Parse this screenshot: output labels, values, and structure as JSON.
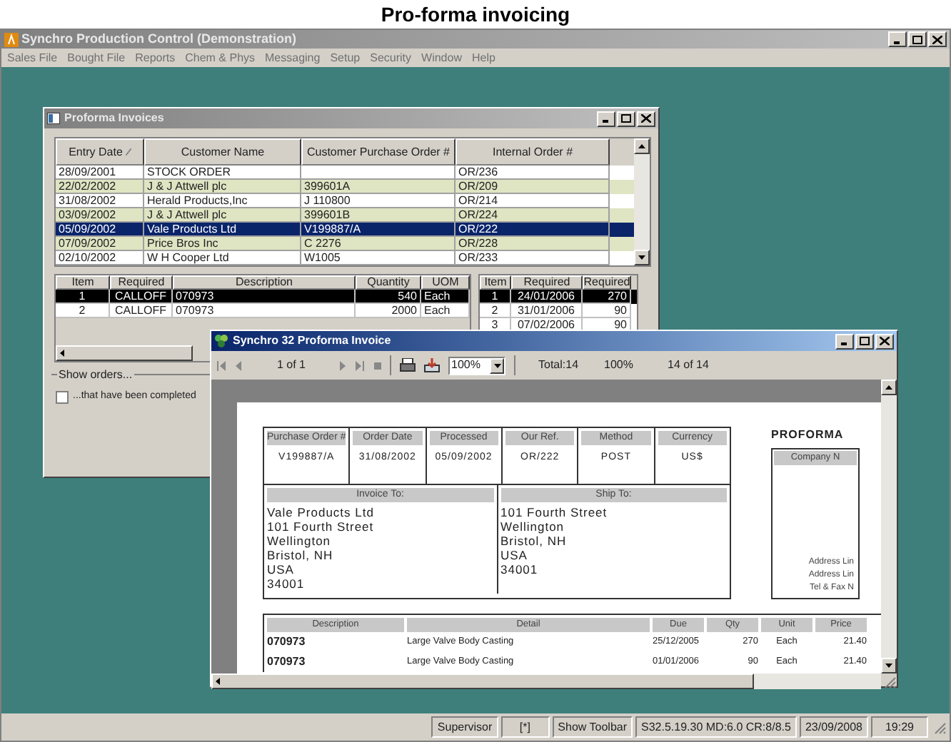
{
  "caption": "Pro-forma invoicing",
  "app": {
    "title": "Synchro Production Control (Demonstration)",
    "menu": [
      "Sales File",
      "Bought File",
      "Reports",
      "Chem & Phys",
      "Messaging",
      "Setup",
      "Security",
      "Window",
      "Help"
    ]
  },
  "proforma_window": {
    "title": "Proforma Invoices",
    "orders": {
      "columns": [
        {
          "label": "Entry Date",
          "sorted": true
        },
        {
          "label": "Customer Name",
          "sorted": false
        },
        {
          "label": "Customer Purchase Order #",
          "sorted": false
        },
        {
          "label": "Internal Order #",
          "sorted": false
        }
      ],
      "rows": [
        {
          "cells": [
            "28/09/2001",
            "STOCK ORDER",
            "",
            "OR/236"
          ],
          "selected": false
        },
        {
          "cells": [
            "22/02/2002",
            "J & J Attwell plc",
            "399601A",
            "OR/209"
          ],
          "selected": false
        },
        {
          "cells": [
            "31/08/2002",
            "Herald Products,Inc",
            "J 110800",
            "OR/214"
          ],
          "selected": false
        },
        {
          "cells": [
            "03/09/2002",
            "J & J Attwell plc",
            "399601B",
            "OR/224"
          ],
          "selected": false
        },
        {
          "cells": [
            "05/09/2002",
            "Vale Products Ltd",
            "V199887/A",
            "OR/222"
          ],
          "selected": true
        },
        {
          "cells": [
            "07/09/2002",
            "Price Bros Inc",
            "C 2276",
            "OR/228"
          ],
          "selected": false
        },
        {
          "cells": [
            "02/10/2002",
            "W H Cooper Ltd",
            "W1005",
            "OR/233"
          ],
          "selected": false
        }
      ]
    },
    "lines": {
      "columns": [
        "Item",
        "Required",
        "Description",
        "Quantity",
        "UOM"
      ],
      "rows": [
        {
          "cells": [
            "1",
            "CALLOFF",
            "070973",
            "540",
            "Each"
          ],
          "selected": true
        },
        {
          "cells": [
            "2",
            "CALLOFF",
            "070973",
            "2000",
            "Each"
          ],
          "selected": false
        }
      ]
    },
    "schedule": {
      "columns": [
        "Item",
        "Required",
        "Required"
      ],
      "rows": [
        {
          "cells": [
            "1",
            "24/01/2006",
            "270"
          ],
          "selected": true
        },
        {
          "cells": [
            "2",
            "31/01/2006",
            "90"
          ],
          "selected": false
        },
        {
          "cells": [
            "3",
            "07/02/2006",
            "90"
          ],
          "selected": false
        }
      ]
    },
    "show_orders": {
      "label": "Show orders...",
      "options": [
        {
          "label": "...that have been completed",
          "checked": false
        }
      ]
    }
  },
  "invoice_window": {
    "title": "Synchro 32 Proforma Invoice",
    "toolbar": {
      "page": "1 of 1",
      "zoom": "100%",
      "total": "Total:14",
      "percent": "100%",
      "count": "14 of 14"
    },
    "document": {
      "header_fields": [
        {
          "label": "Purchase Order #",
          "value": "V199887/A"
        },
        {
          "label": "Order Date",
          "value": "31/08/2002"
        },
        {
          "label": "Processed",
          "value": "05/09/2002"
        },
        {
          "label": "Our Ref.",
          "value": "OR/222"
        },
        {
          "label": "Method",
          "value": "POST"
        },
        {
          "label": "Currency",
          "value": "US$"
        }
      ],
      "invoice_to": {
        "label": "Invoice To:",
        "lines": [
          "Vale Products Ltd",
          "101 Fourth Street",
          "Wellington",
          "Bristol, NH",
          "USA",
          "34001"
        ]
      },
      "ship_to": {
        "label": "Ship To:",
        "lines": [
          "101 Fourth Street",
          "Wellington",
          "Bristol, NH",
          "USA",
          "34001"
        ]
      },
      "side": {
        "title": "PROFORMA",
        "company_label": "Company N",
        "lines": [
          "Address Lin",
          "Address Lin",
          "Tel & Fax N"
        ]
      },
      "items": {
        "columns": [
          "Description",
          "Detail",
          "Due",
          "Qty",
          "Unit",
          "Price"
        ],
        "rows": [
          [
            "070973",
            "Large Valve Body Casting",
            "25/12/2005",
            "270",
            "Each",
            "21.40"
          ],
          [
            "070973",
            "Large Valve Body Casting",
            "01/01/2006",
            "90",
            "Each",
            "21.40"
          ]
        ]
      }
    }
  },
  "status_bar": [
    "Supervisor",
    "[*]",
    "Show Toolbar",
    "S32.5.19.30 MD:6.0 CR:8/8.5",
    "23/09/2008",
    "19:29"
  ]
}
